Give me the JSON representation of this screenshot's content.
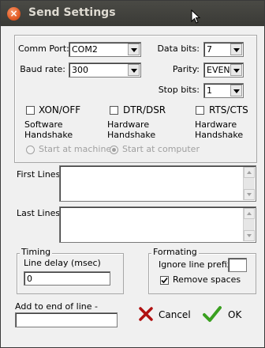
{
  "window": {
    "title": "Send Settings",
    "close_icon": "close-icon"
  },
  "serial": {
    "comm_port": {
      "label": "Comm Port:",
      "value": "COM2"
    },
    "baud_rate": {
      "label": "Baud rate:",
      "value": "300"
    },
    "data_bits": {
      "label": "Data bits:",
      "value": "7"
    },
    "parity": {
      "label": "Parity:",
      "value": "EVEN"
    },
    "stop_bits": {
      "label": "Stop bits:",
      "value": "1"
    }
  },
  "handshake": {
    "xon": {
      "label": "XON/OFF",
      "desc1": "Software",
      "desc2": "Handshake",
      "checked": false
    },
    "dtr": {
      "label": "DTR/DSR",
      "desc1": "Hardware",
      "desc2": "Handshake",
      "checked": false
    },
    "rts": {
      "label": "RTS/CTS",
      "desc1": "Hardware",
      "desc2": "Handshake",
      "checked": false
    }
  },
  "start": {
    "machine": "Start at machine",
    "computer": "Start at computer",
    "selected": "computer"
  },
  "lines": {
    "first": {
      "label": "First Lines",
      "value": ""
    },
    "last": {
      "label": "Last Lines",
      "value": ""
    }
  },
  "timing": {
    "title": "Timing",
    "label": "Line delay (msec)",
    "value": "0"
  },
  "formating": {
    "title": "Formating",
    "ignore_label": "Ignore line prefix -",
    "ignore_value": "",
    "remove_spaces_label": "Remove spaces",
    "remove_spaces_checked": true
  },
  "add_end": {
    "label": "Add to end of line -",
    "value": ""
  },
  "buttons": {
    "cancel": "Cancel",
    "ok": "OK"
  },
  "colors": {
    "cancel_x": "#b01010",
    "ok_check": "#3aa020"
  }
}
